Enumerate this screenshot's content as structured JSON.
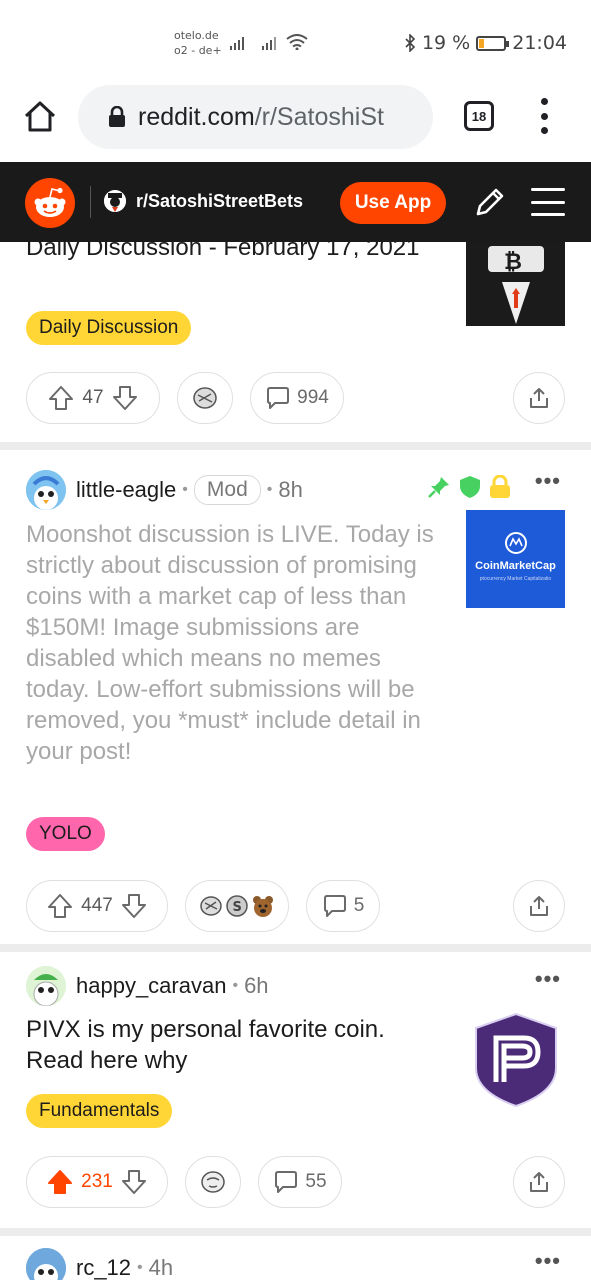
{
  "status_bar": {
    "carrier_name": "otelo.de",
    "carrier_sub": "o2 - de+",
    "battery_percent": "19 %",
    "battery_level": 0.19,
    "time": "21:04"
  },
  "browser": {
    "url_host": "reddit.com",
    "url_path": "/r/SatoshiSt",
    "tab_count": "18"
  },
  "header": {
    "subreddit": "r/SatoshiStreetBets",
    "use_app_label": "Use App",
    "accent": "#ff4500"
  },
  "posts": [
    {
      "title": "Daily Discussion - February 17, 2021",
      "flair": "Daily Discussion",
      "flair_color": "#ffd635",
      "votes": "47",
      "comments": "994"
    },
    {
      "author": "little-eagle",
      "badge": "Mod",
      "time": "8h",
      "title": "Moonshot discussion is LIVE. Today is strictly about discussion of promising coins with a market cap of less than $150M! Image submissions are disabled which means no memes today. Low-effort submissions will be removed, you *must* include detail in your post!",
      "flair": "YOLO",
      "flair_color": "#ff66ac",
      "votes": "447",
      "comments": "5",
      "thumb_text": "CoinMarketCap",
      "thumb_sub": "ptocurrency Market Capitalizatio"
    },
    {
      "author": "happy_caravan",
      "time": "6h",
      "title": "PIVX is my personal favorite coin. Read here why",
      "flair": "Fundamentals",
      "flair_color": "#ffd635",
      "votes": "231",
      "comments": "55"
    },
    {
      "author": "rc_12",
      "time": "4h"
    }
  ]
}
